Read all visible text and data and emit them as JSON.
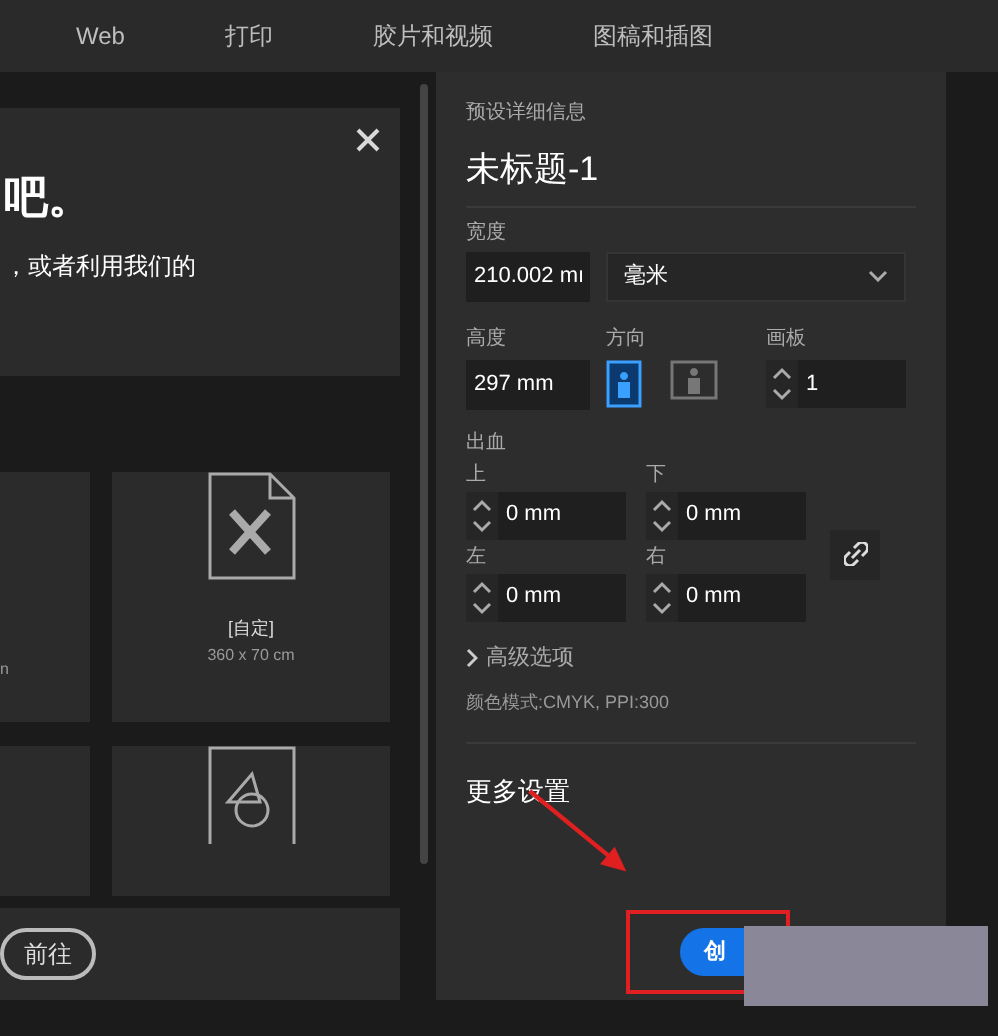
{
  "tabs": [
    {
      "label": "Web",
      "selected": false
    },
    {
      "label": "打印",
      "selected": false
    },
    {
      "label": "胶片和视频",
      "selected": false
    },
    {
      "label": "图稿和插图",
      "selected": false
    }
  ],
  "welcome_card": {
    "heading": "吧。",
    "text": "，或者利用我们的"
  },
  "presets": [
    {
      "kind": "partial",
      "size": "n"
    },
    {
      "kind": "custom",
      "name": "[自定]",
      "size": "360 x 70 cm"
    },
    {
      "kind": "partial"
    },
    {
      "kind": "shapes"
    }
  ],
  "go_button": "前往",
  "details": {
    "title": "预设详细信息",
    "doc_name": "未标题-1",
    "width_label": "宽度",
    "width": "210.002 mı",
    "unit": "毫米",
    "height_label": "高度",
    "height": "297 mm",
    "orientation_label": "方向",
    "orientations": [
      {
        "kind": "portrait",
        "selected": true
      },
      {
        "kind": "landscape",
        "selected": false
      }
    ],
    "artboards_label": "画板",
    "artboards": "1",
    "bleed_label": "出血",
    "bleeds": [
      {
        "label": "上",
        "value": "0 mm"
      },
      {
        "label": "下",
        "value": "0 mm"
      },
      {
        "label": "左",
        "value": "0 mm"
      },
      {
        "label": "右",
        "value": "0 mm"
      }
    ],
    "advanced": "高级选项",
    "color_info": "颜色模式:CMYK, PPI:300",
    "more_settings": "更多设置",
    "create_button": "创"
  }
}
